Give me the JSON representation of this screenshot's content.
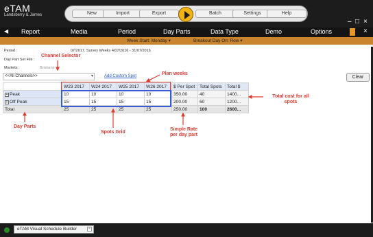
{
  "app": {
    "logo_name": "eTAM",
    "logo_sub": "Landsberry & James"
  },
  "toolbar": {
    "buttons": [
      "New",
      "Import",
      "Export",
      "Batch",
      "Settings",
      "Help"
    ]
  },
  "window_controls": {
    "minimize": "–",
    "maximize": "□",
    "close": "×"
  },
  "nav": {
    "left_arrow": "◀",
    "items": [
      "Report",
      "Media",
      "Period",
      "Day Parts",
      "Data Type",
      "Demo",
      "Options"
    ],
    "stub": "S",
    "close": "×"
  },
  "subbar": {
    "week_start": "Week Start: Monday ▾",
    "breakout": "Breakout Day On: Row ▾"
  },
  "info": {
    "period_label": "Period :",
    "period_value": "07/2017, Survey Weeks 4/07/2016 - 31/07/2016",
    "daypart_label": "Day Part Set File :",
    "markets_label": "Markets :",
    "markets_value": "Brisbane"
  },
  "channel_select": {
    "value": "<<All Channels>>",
    "arrow": "▾"
  },
  "add_custom_spot": "Add Custom Spot",
  "clear_button": "Clear",
  "grid": {
    "headers": [
      "W23 2017",
      "W24 2017",
      "W25 2017",
      "W26 2017",
      "$ Per Spot",
      "Total Spots",
      "Total $"
    ],
    "rows": [
      {
        "label": "Peak",
        "expander": "+",
        "cells": [
          "10",
          "10",
          "10",
          "10",
          "350.00",
          "40",
          "1400..."
        ]
      },
      {
        "label": "Off Peak",
        "expander": "+",
        "cells": [
          "15",
          "15",
          "15",
          "15",
          "200.00",
          "60",
          "1200..."
        ]
      }
    ],
    "total": {
      "label": "Total",
      "cells": [
        "25",
        "25",
        "25",
        "25",
        "250.00",
        "100",
        "2600..."
      ]
    }
  },
  "annotations": {
    "channel_selector": "Channel Selector",
    "plan_weeks": "Plan weeks",
    "total_cost": "Total cost for all spots",
    "day_parts": "Day Parts",
    "spots_grid": "Spots Grid",
    "simple_rate": "Simple Rate per day part"
  },
  "footer": {
    "tab_label": "eTAM Visual Schedule Builder",
    "close": "×"
  },
  "colors": {
    "titlebar": "#1c1c1c",
    "subbar": "#c9842d",
    "annotation_red": "#e3392f",
    "grid_blue": "#3a5bd6",
    "play_button": "#f1b312"
  }
}
